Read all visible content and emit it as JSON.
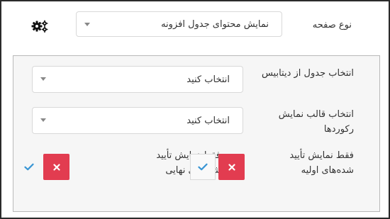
{
  "header": {
    "page_type_label": "نوع صفحه",
    "page_type_value": "نمایش محتوای جدول افزونه"
  },
  "settings": {
    "database_table_label": "انتخاب جدول از دیتابیس",
    "database_table_value": "انتخاب کنید",
    "record_template_label": "انتخاب قالب نمایش رکوردها",
    "record_template_value": "انتخاب کنید",
    "show_initial_approved_label": "فقط نمایش تأیید شده‌های اولیه",
    "show_final_approved_label": "فقط نمایش تأیید شده‌های نهایی"
  },
  "icons": {
    "settings": "gears-icon",
    "dropdown": "caret-down-icon",
    "reject": "close-icon",
    "accept": "check-icon"
  },
  "colors": {
    "reject_button": "#e23c50",
    "accept_check": "#3a96d4",
    "panel_background": "#f6f6f6"
  }
}
